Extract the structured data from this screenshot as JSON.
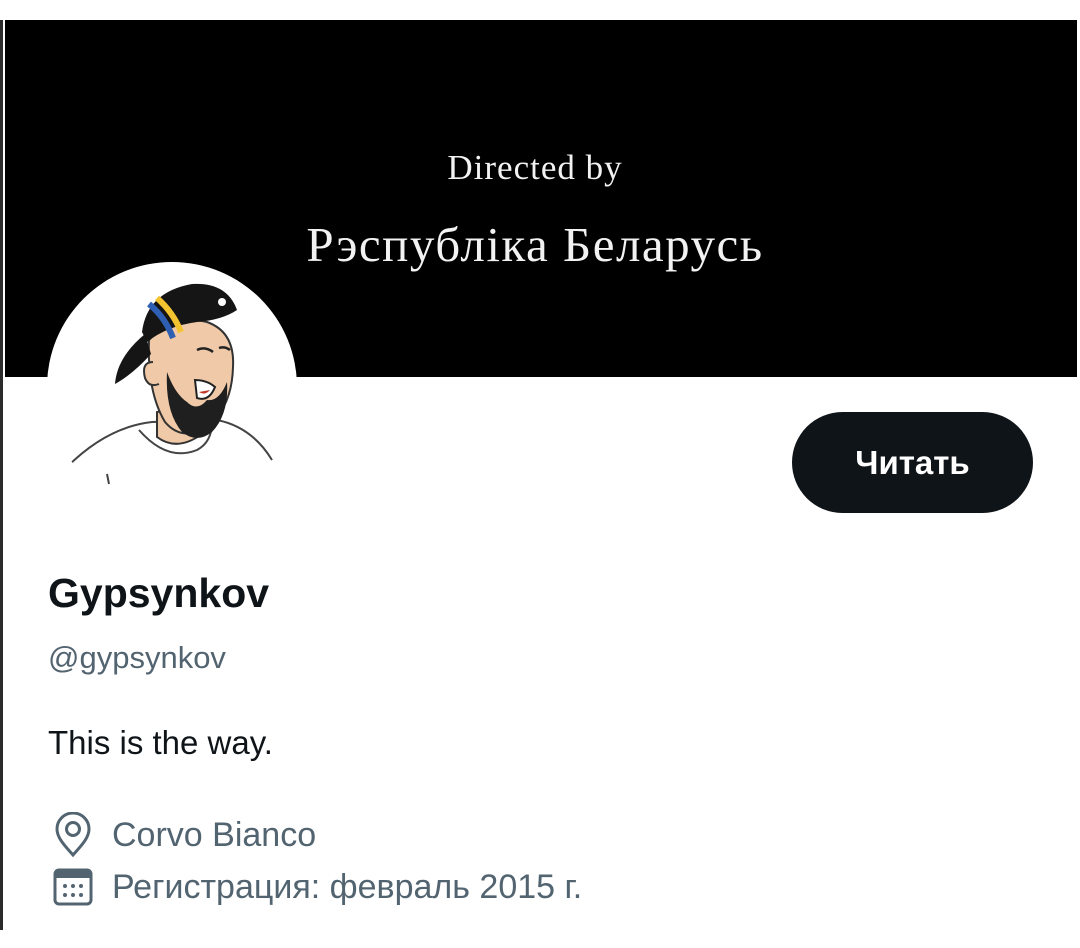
{
  "banner": {
    "line1": "Directed by",
    "line2": "Рэспубліка Беларусь"
  },
  "profile": {
    "display_name": "Gypsynkov",
    "handle": "@gypsynkov",
    "bio": "This is the way.",
    "location": "Corvo Bianco",
    "joined": "Регистрация: февраль 2015 г."
  },
  "actions": {
    "follow_label": "Читать"
  },
  "icons": {
    "location": "location-pin-icon",
    "joined": "calendar-icon"
  },
  "colors": {
    "banner_bg": "#000000",
    "button_bg": "#0f1419",
    "secondary_text": "#536471",
    "flag_blue": "#2f5fb3",
    "flag_yellow": "#f4c430"
  }
}
